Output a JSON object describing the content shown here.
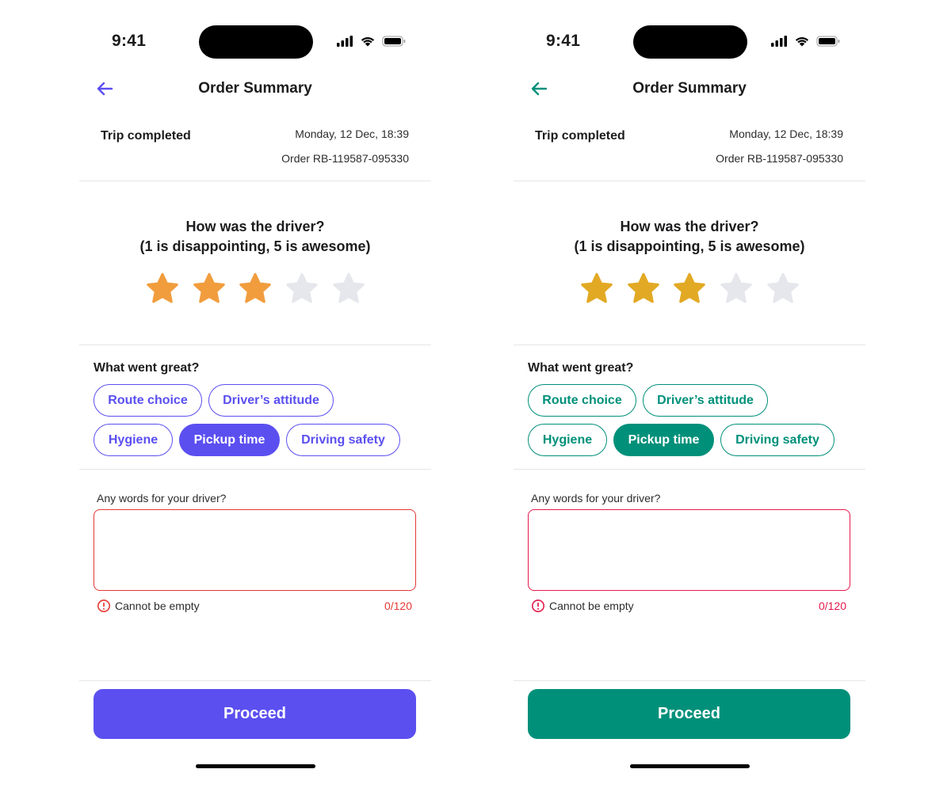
{
  "screens": [
    {
      "status": {
        "time": "9:41"
      },
      "header": {
        "title": "Order Summary"
      },
      "trip": {
        "label": "Trip completed",
        "date": "Monday, 12 Dec, 18:39",
        "order": "Order RB-119587-095330"
      },
      "rating": {
        "question_line1": "How was the driver?",
        "question_line2": "(1 is disappointing, 5 is awesome)",
        "value": 3,
        "max": 5
      },
      "great": {
        "title": "What went great?",
        "chips": [
          {
            "label": "Route choice",
            "selected": false
          },
          {
            "label": "Driver’s attitude",
            "selected": false
          },
          {
            "label": "Hygiene",
            "selected": false
          },
          {
            "label": "Pickup time",
            "selected": true
          },
          {
            "label": "Driving safety",
            "selected": false
          }
        ]
      },
      "comment": {
        "label": "Any words for your driver?",
        "value": "",
        "error": "Cannot be empty",
        "counter": "0/120"
      },
      "proceed_label": "Proceed",
      "colors": {
        "accent": "#5b4ff0",
        "star_filled": "#f19d3e",
        "star_empty": "#e6e7ec",
        "error": "#e53935"
      }
    },
    {
      "status": {
        "time": "9:41"
      },
      "header": {
        "title": "Order Summary"
      },
      "trip": {
        "label": "Trip completed",
        "date": "Monday, 12 Dec, 18:39",
        "order": "Order RB-119587-095330"
      },
      "rating": {
        "question_line1": "How was the driver?",
        "question_line2": "(1 is disappointing, 5 is awesome)",
        "value": 3,
        "max": 5
      },
      "great": {
        "title": "What went great?",
        "chips": [
          {
            "label": "Route choice",
            "selected": false
          },
          {
            "label": "Driver’s attitude",
            "selected": false
          },
          {
            "label": "Hygiene",
            "selected": false
          },
          {
            "label": "Pickup time",
            "selected": true
          },
          {
            "label": "Driving safety",
            "selected": false
          }
        ]
      },
      "comment": {
        "label": "Any words for your driver?",
        "value": "",
        "error": "Cannot be empty",
        "counter": "0/120"
      },
      "proceed_label": "Proceed",
      "colors": {
        "accent": "#00907a",
        "star_filled": "#e2a924",
        "star_empty": "#e6e7ec",
        "error": "#e5194a"
      }
    }
  ],
  "icons": {
    "back": "arrow-left-icon",
    "signal": "cellular-signal-icon",
    "wifi": "wifi-icon",
    "battery": "battery-icon",
    "star": "star-icon",
    "error": "alert-circle-icon"
  }
}
